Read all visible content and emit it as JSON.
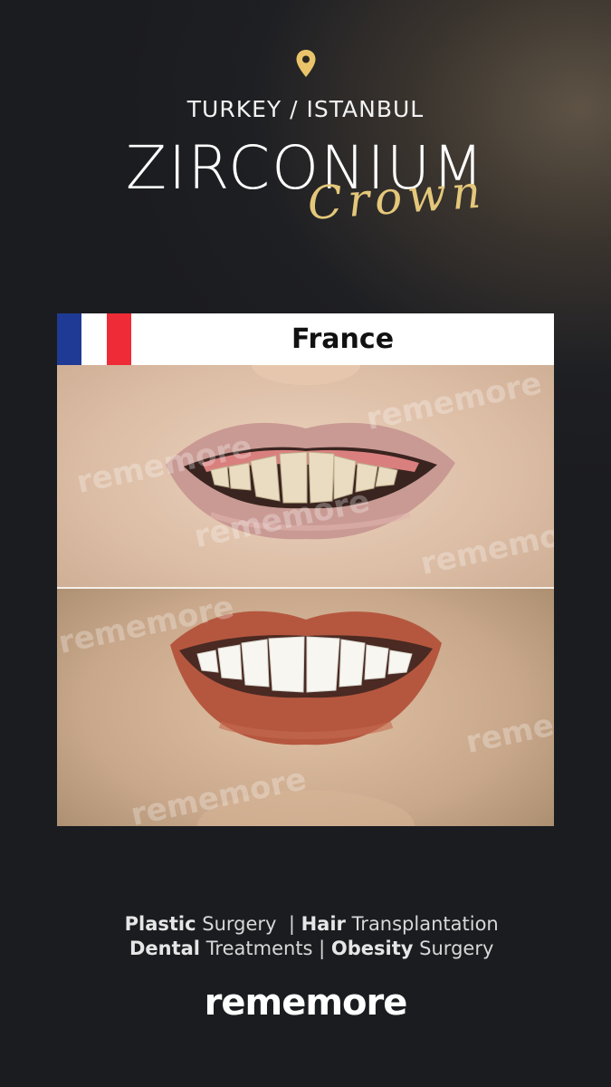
{
  "location": "TURKEY / ISTANBUL",
  "title": "ZIRCONIUM",
  "subtitle_script": "Crown",
  "country": "France",
  "watermark": "rememore",
  "tagline": {
    "line1": [
      {
        "bold": "Plastic",
        "rest": " Surgery  | "
      },
      {
        "bold": "Hair",
        "rest": " Transplantation"
      }
    ],
    "line2": [
      {
        "bold": "Dental",
        "rest": " Treatments | "
      },
      {
        "bold": "Obesity",
        "rest": " Surgery"
      }
    ]
  },
  "brand": "rememore",
  "colors": {
    "accent_gold": "#e4c77a",
    "background": "#1e1f23",
    "flag_blue": "#1f3a94",
    "flag_red": "#ee2b36"
  },
  "icons": [
    "location-pin-icon"
  ]
}
